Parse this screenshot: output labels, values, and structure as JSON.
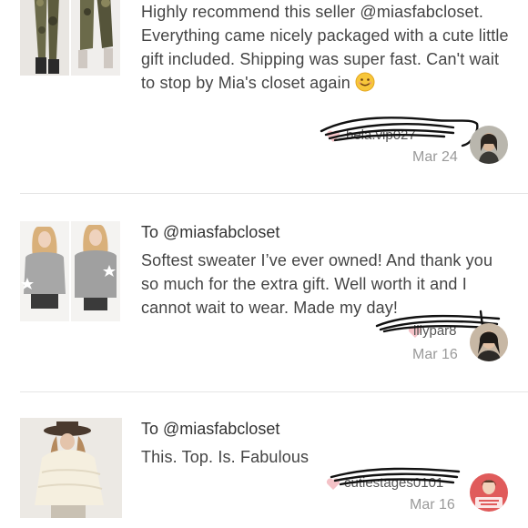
{
  "reviews": [
    {
      "to": "",
      "text": "Highly recommend this seller @miasfabcloset. Everything came nicely packaged with a cute little gift included. Shipping was super fast. Can't wait to stop by Mia's closet again",
      "emoji": "😊",
      "username": "bela.vip027",
      "date": "Mar 24",
      "thumbnail_icons": [
        "camo-leggings-photo",
        "camo-leggings-photo-2"
      ]
    },
    {
      "to": "To @miasfabcloset",
      "text": "Softest sweater I’ve ever owned! And thank you so much for the extra gift. Well worth it and I cannot wait to wear. Made my day!",
      "username": "lilypar8",
      "date": "Mar 16",
      "thumbnail_icons": [
        "star-sweater-photo",
        "star-sweater-photo-2"
      ]
    },
    {
      "to": "To @miasfabcloset",
      "text": "This. Top. Is. Fabulous",
      "username": "cutiestages0101",
      "date": "Mar 16",
      "thumbnail_icons": [
        "ruffle-top-photo"
      ]
    }
  ],
  "colors": {
    "heart": "#f4c2c7",
    "divider": "#e5e5e5",
    "date": "#9a9a9a",
    "text": "#444444"
  }
}
